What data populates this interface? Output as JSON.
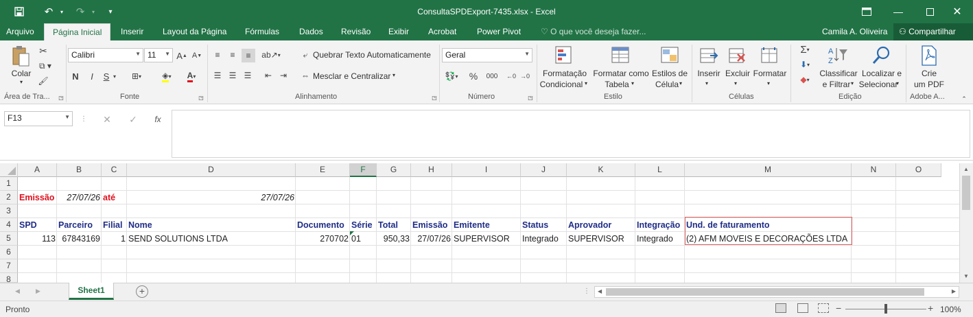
{
  "window": {
    "title": "ConsultaSPDExport-7435.xlsx - Excel",
    "user": "Camila A. Oliveira",
    "share_label": "Compartilhar",
    "tell_me_placeholder": "O que você deseja fazer..."
  },
  "tabs": [
    "Arquivo",
    "Página Inicial",
    "Inserir",
    "Layout da Página",
    "Fórmulas",
    "Dados",
    "Revisão",
    "Exibir",
    "Acrobat",
    "Power Pivot"
  ],
  "active_tab": "Página Inicial",
  "ribbon": {
    "clipboard": {
      "paste_label": "Colar",
      "group_label": "Área de Tra..."
    },
    "font": {
      "name": "Calibri",
      "size": "11",
      "bold": "N",
      "italic": "I",
      "underline": "S",
      "group_label": "Fonte"
    },
    "alignment": {
      "wrap_label": "Quebrar Texto Automaticamente",
      "merge_label": "Mesclar e Centralizar",
      "group_label": "Alinhamento"
    },
    "number": {
      "format": "Geral",
      "percent": "%",
      "thousands": "000",
      "group_label": "Número"
    },
    "styles": {
      "cond_format_1": "Formatação",
      "cond_format_2": "Condicional",
      "format_table_1": "Formatar como",
      "format_table_2": "Tabela",
      "cell_styles_1": "Estilos de",
      "cell_styles_2": "Célula",
      "group_label": "Estilo"
    },
    "cells": {
      "insert": "Inserir",
      "delete": "Excluir",
      "format": "Formatar",
      "group_label": "Células"
    },
    "editing": {
      "sort_1": "Classificar",
      "sort_2": "e Filtrar",
      "find_1": "Localizar e",
      "find_2": "Selecionar",
      "group_label": "Edição"
    },
    "adobe": {
      "create_1": "Crie",
      "create_2": "um PDF",
      "group_label": "Adobe A..."
    }
  },
  "formula_bar": {
    "name_box": "F13",
    "fx": "fx",
    "formula": ""
  },
  "columns": [
    "A",
    "B",
    "C",
    "D",
    "E",
    "F",
    "G",
    "H",
    "I",
    "J",
    "K",
    "L",
    "M",
    "N",
    "O"
  ],
  "rows": [
    "1",
    "2",
    "3",
    "4",
    "5",
    "6",
    "7",
    "8"
  ],
  "cells": {
    "A2": "Emissão",
    "B2": "27/07/26",
    "C2": "até",
    "D2": "27/07/26",
    "A4": "SPD",
    "B4": "Parceiro",
    "C4": "Filial",
    "D4": "Nome",
    "E4": "Documento",
    "F4": "Série",
    "G4": "Total",
    "H4": "Emissão",
    "I4": "Emitente",
    "J4": "Status",
    "K4": "Aprovador",
    "L4": "Integração",
    "M4": "Und. de faturamento",
    "A5": "113",
    "B5": "67843169",
    "C5": "1",
    "D5": "SEND SOLUTIONS LTDA",
    "E5": "270702",
    "F5": "01",
    "G5": "950,33",
    "H5": "27/07/26",
    "I5": "SUPERVISOR",
    "J5": "Integrado",
    "K5": "SUPERVISOR",
    "L5": "Integrado",
    "M5": "(2) AFM MOVEIS E DECORAÇÕES LTDA"
  },
  "sheet_tab": "Sheet1",
  "status": {
    "mode": "Pronto",
    "zoom": "100%"
  },
  "colors": {
    "excel_green": "#217346",
    "header_navy": "#1f2d86",
    "label_red": "#e0101e"
  }
}
